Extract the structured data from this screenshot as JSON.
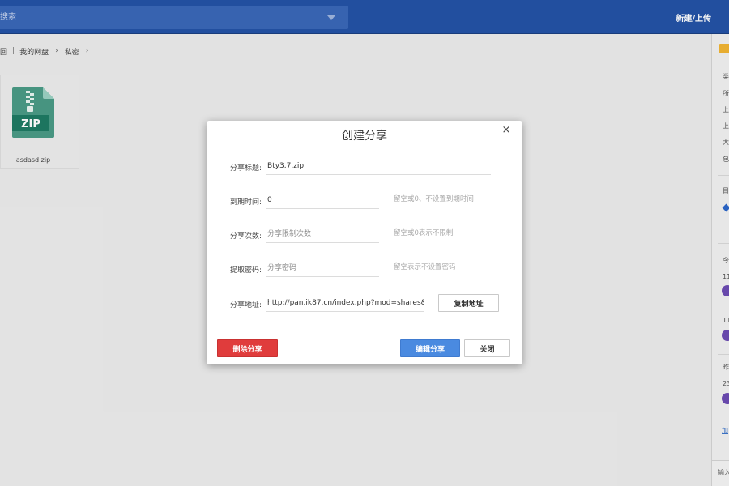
{
  "topbar": {
    "search_placeholder": "搜索",
    "new_upload_label": "新建/上传"
  },
  "breadcrumb": {
    "back": "回",
    "separator": "|",
    "items": [
      "我的网盘",
      "私密"
    ],
    "arrow": "›"
  },
  "files": [
    {
      "name": "asdasd.zip",
      "icon": "zip-file-icon",
      "icon_text": "ZIP"
    }
  ],
  "right_panel": {
    "lines": [
      "类",
      "所",
      "上",
      "上",
      "大",
      "包",
      "目",
      "今",
      "11",
      "11",
      "昨",
      "23"
    ],
    "link": "加",
    "input_placeholder": "输入"
  },
  "modal": {
    "title": "创建分享",
    "close_symbol": "×",
    "fields": {
      "title": {
        "label": "分享标题:",
        "value": "Bty3.7.zip",
        "placeholder": ""
      },
      "expire": {
        "label": "到期时间:",
        "value": "0",
        "placeholder": "",
        "hint": "留空或0、不设置到期时间"
      },
      "times": {
        "label": "分享次数:",
        "value": "",
        "placeholder": "分享限制次数",
        "hint": "留空或0表示不限制"
      },
      "password": {
        "label": "提取密码:",
        "value": "",
        "placeholder": "分享密码",
        "hint": "留空表示不设置密码"
      },
      "url": {
        "label": "分享地址:",
        "value": "http://pan.ik87.cn/index.php?mod=shares&"
      }
    },
    "buttons": {
      "copy": "复制地址",
      "delete": "删除分享",
      "edit": "编辑分享",
      "close": "关闭"
    }
  },
  "colors": {
    "topbar": "#2453a6",
    "delete": "#e03c3c",
    "edit": "#4a8ae0",
    "zip_green": "#1f8a6d"
  }
}
